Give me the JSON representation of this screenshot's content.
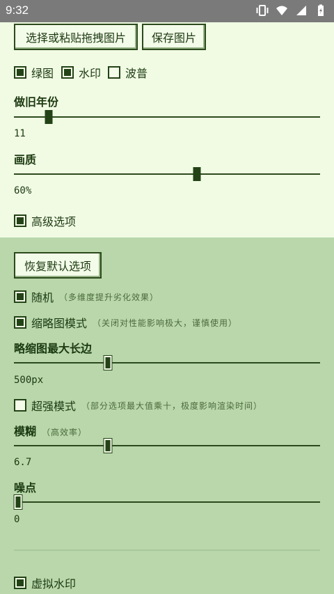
{
  "status_bar": {
    "time": "9:32",
    "icons": [
      "vibrate-icon",
      "wifi-icon",
      "signal-icon",
      "battery-charging-icon"
    ]
  },
  "top_panel": {
    "select_button": "选择或粘贴拖拽图片",
    "save_button": "保存图片",
    "options": [
      {
        "label": "绿图",
        "checked": true
      },
      {
        "label": "水印",
        "checked": true
      },
      {
        "label": "波普",
        "checked": false
      }
    ],
    "year_heading": "做旧年份",
    "year_value": "11",
    "year_slider_fraction": 0.11,
    "quality_heading": "画质",
    "quality_value": "60%",
    "quality_slider_fraction": 0.6,
    "advanced": {
      "label": "高级选项",
      "checked": true
    }
  },
  "advanced_panel": {
    "reset_button": "恢复默认选项",
    "random": {
      "label": "随机",
      "note": "（多维度提升劣化效果）",
      "checked": true
    },
    "thumbnail_mode": {
      "label": "缩略图模式",
      "note": "（关闭对性能影响极大，谨慎使用）",
      "checked": true
    },
    "thumb_edge_heading": "略缩图最大长边",
    "thumb_edge_value": "500px",
    "thumb_edge_fraction": 0.31,
    "super_mode": {
      "label": "超强模式",
      "note": "（部分选项最大值乘十，极度影响渲染时间）",
      "checked": false
    },
    "blur_heading": "模糊",
    "blur_note": "（高效率）",
    "blur_value": "6.7",
    "blur_fraction": 0.31,
    "noise_heading": "噪点",
    "noise_value": "0",
    "noise_fraction": 0.0,
    "virtual_watermark": {
      "label": "虚拟水印",
      "checked": true
    }
  },
  "colors": {
    "top_bg": "#f1fbe4",
    "panel_bg": "#b9d7ab",
    "ink": "#1c3a10"
  }
}
